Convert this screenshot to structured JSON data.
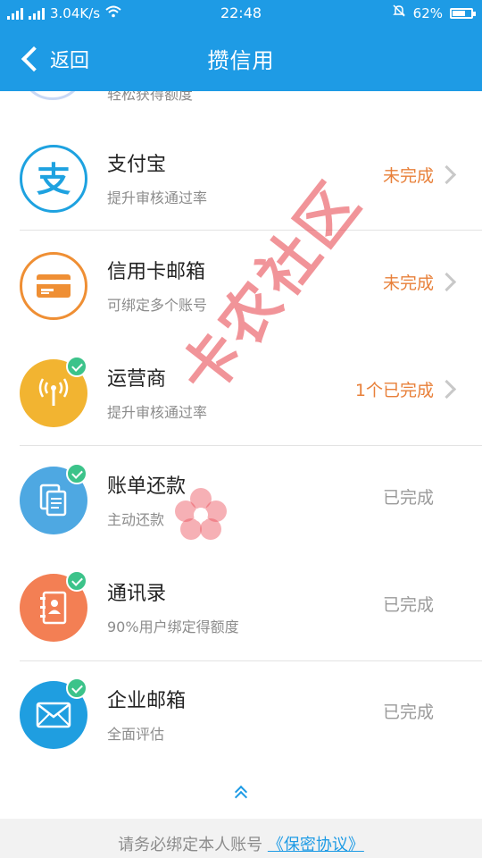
{
  "status_bar": {
    "network_speed": "3.04K/s",
    "time": "22:48",
    "battery": "62%"
  },
  "header": {
    "back_label": "返回",
    "title": "攒信用"
  },
  "partial_row": {
    "desc": "轻松获得额度"
  },
  "items": [
    {
      "name": "支付宝",
      "desc": "提升审核通过率",
      "status": "未完成",
      "status_type": "pending",
      "icon": "alipay-icon",
      "color": "#1ea2e0",
      "verified": false,
      "has_arrow": true
    },
    {
      "name": "信用卡邮箱",
      "desc": "可绑定多个账号",
      "status": "未完成",
      "status_type": "pending",
      "icon": "credit-card-icon",
      "color": "#ef8f34",
      "verified": false,
      "has_arrow": true
    },
    {
      "name": "运营商",
      "desc": "提升审核通过率",
      "status": "1个已完成",
      "status_type": "pending",
      "icon": "signal-tower-icon",
      "color": "#f2b431",
      "verified": true,
      "has_arrow": true
    },
    {
      "name": "账单还款",
      "desc": "主动还款",
      "status": "已完成",
      "status_type": "done",
      "icon": "bill-document-icon",
      "color": "#4ea8e2",
      "verified": true,
      "has_arrow": false
    },
    {
      "name": "通讯录",
      "desc": "90%用户绑定得额度",
      "status": "已完成",
      "status_type": "done",
      "icon": "contacts-book-icon",
      "color": "#f37f54",
      "verified": true,
      "has_arrow": false
    },
    {
      "name": "企业邮箱",
      "desc": "全面评估",
      "status": "已完成",
      "status_type": "done",
      "icon": "envelope-icon",
      "color": "#1f9ee0",
      "verified": true,
      "has_arrow": false
    }
  ],
  "footer": {
    "notice": "请务必绑定本人账号",
    "link": "《保密协议》"
  },
  "watermark": "卡农社区"
}
